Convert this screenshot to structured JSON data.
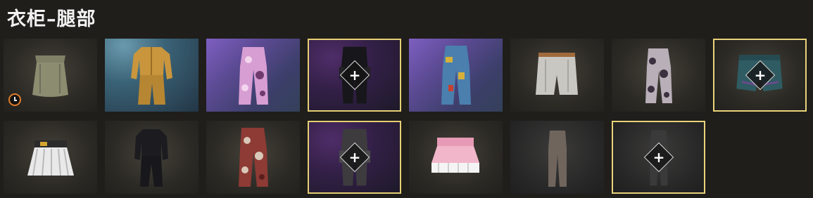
{
  "header": {
    "title": "衣柜–腿部"
  },
  "accent_color": "#e9d27a",
  "slots": [
    {
      "name": "slot-olive-skirt",
      "item": "olive-skirt-icon",
      "background": "dark",
      "selected": false,
      "empty_add": false,
      "timed": true
    },
    {
      "name": "slot-yellow-tracksuit",
      "item": "yellow-tracksuit-icon",
      "background": "blue",
      "selected": false,
      "empty_add": false,
      "timed": false
    },
    {
      "name": "slot-pink-camo-pants",
      "item": "pink-camo-pants-icon",
      "background": "purple",
      "selected": false,
      "empty_add": false,
      "timed": false
    },
    {
      "name": "slot-black-cargo-pants",
      "item": "black-cargo-pants-icon",
      "background": "purple-dark",
      "selected": true,
      "empty_add": true,
      "timed": false
    },
    {
      "name": "slot-graffiti-jeans",
      "item": "graffiti-jeans-icon",
      "background": "purple",
      "selected": false,
      "empty_add": false,
      "timed": false
    },
    {
      "name": "slot-white-shorts",
      "item": "white-shorts-icon",
      "background": "dark",
      "selected": false,
      "empty_add": false,
      "timed": false
    },
    {
      "name": "slot-camo-pants",
      "item": "camo-pants-icon",
      "background": "dark",
      "selected": false,
      "empty_add": false,
      "timed": false
    },
    {
      "name": "slot-teal-shorts",
      "item": "teal-shorts-icon",
      "background": "dark",
      "selected": true,
      "empty_add": true,
      "timed": false
    },
    {
      "name": "slot-white-pleated-skirt",
      "item": "white-pleated-skirt-icon",
      "background": "dark",
      "selected": false,
      "empty_add": false,
      "timed": false
    },
    {
      "name": "slot-black-suit",
      "item": "black-suit-icon",
      "background": "dark",
      "selected": false,
      "empty_add": false,
      "timed": false
    },
    {
      "name": "slot-red-camo-pants",
      "item": "red-camo-pants-icon",
      "background": "dark",
      "selected": false,
      "empty_add": false,
      "timed": false
    },
    {
      "name": "slot-gray-cargo-pants",
      "item": "gray-cargo-pants-icon",
      "background": "purple-dark",
      "selected": true,
      "empty_add": true,
      "timed": false
    },
    {
      "name": "slot-pink-skirt",
      "item": "pink-skirt-icon",
      "background": "dark",
      "selected": false,
      "empty_add": false,
      "timed": false
    },
    {
      "name": "slot-brown-slim-pants",
      "item": "brown-slim-pants-icon",
      "background": "gray",
      "selected": false,
      "empty_add": false,
      "timed": false
    },
    {
      "name": "slot-dark-slim-pants",
      "item": "dark-slim-pants-icon",
      "background": "gray",
      "selected": true,
      "empty_add": true,
      "timed": false
    }
  ]
}
